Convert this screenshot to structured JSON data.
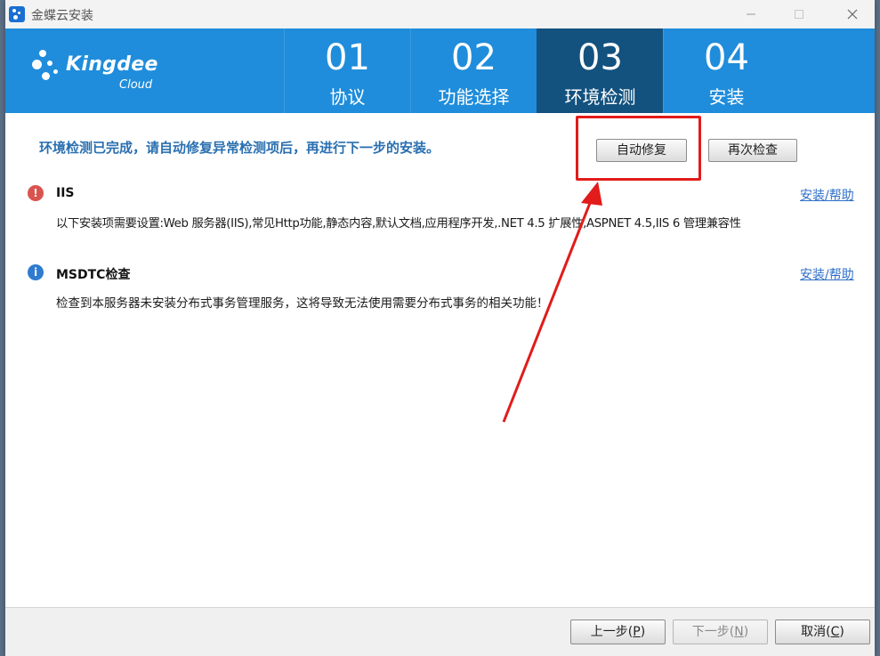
{
  "window": {
    "title": "金蝶云安装"
  },
  "logo": {
    "brand": "Kingdee",
    "sub": "Cloud"
  },
  "steps": [
    {
      "num": "01",
      "label": "协议"
    },
    {
      "num": "02",
      "label": "功能选择"
    },
    {
      "num": "03",
      "label": "环境检测",
      "active": true
    },
    {
      "num": "04",
      "label": "安装"
    }
  ],
  "intro": "环境检测已完成，请自动修复异常检测项后，再进行下一步的安装。",
  "buttons": {
    "auto_fix": "自动修复",
    "recheck": "再次检查"
  },
  "items": [
    {
      "icon": "error-icon",
      "icon_glyph": "!",
      "icon_color": "#d9534f",
      "title": "IIS",
      "link": "安装/帮助",
      "desc": "以下安装项需要设置:Web 服务器(IIS),常见Http功能,静态内容,默认文档,应用程序开发,.NET 4.5 扩展性,ASPNET 4.5,IIS 6 管理兼容性",
      "desc_color": "#1b1b1b"
    },
    {
      "icon": "info-icon",
      "icon_glyph": "i",
      "icon_color": "#2f7bd0",
      "title": "MSDTC检查",
      "link": "安装/帮助",
      "desc": "检查到本服务器未安装分布式事务管理服务，这将导致无法使用需要分布式事务的相关功能！",
      "desc_color": "#1b1b1b"
    }
  ],
  "footer": {
    "prev_main": "上一步(",
    "prev_key": "P",
    "prev_end": ")",
    "next_main": "下一步(",
    "next_key": "N",
    "next_end": ")",
    "cancel_main": "取消(",
    "cancel_key": "C",
    "cancel_end": ")"
  },
  "colors": {
    "header_bg": "#1f8ddb",
    "active_step_bg": "#13527f",
    "annotation_red": "#e21b1b"
  }
}
